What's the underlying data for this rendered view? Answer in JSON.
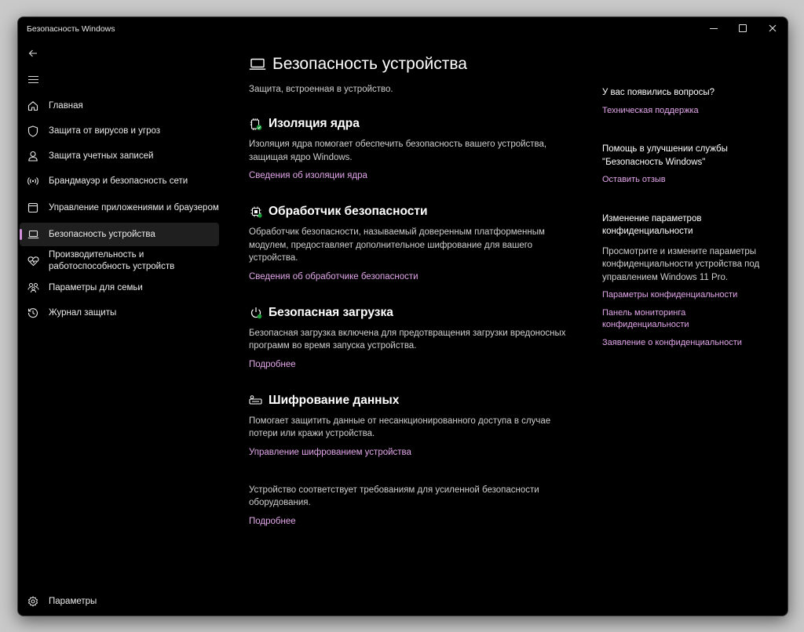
{
  "window": {
    "title": "Безопасность Windows",
    "accent": "#d38fdc",
    "link_color": "#e2a6ea"
  },
  "sidebar": {
    "items": [
      {
        "label": "Главная",
        "icon": "home-icon"
      },
      {
        "label": "Защита от вирусов и угроз",
        "icon": "shield-icon"
      },
      {
        "label": "Защита учетных записей",
        "icon": "person-icon"
      },
      {
        "label": "Брандмауэр и безопасность сети",
        "icon": "wifi-icon"
      },
      {
        "label": "Управление приложениями и браузером",
        "icon": "app-browser-icon"
      },
      {
        "label": "Безопасность устройства",
        "icon": "laptop-icon",
        "selected": true
      },
      {
        "label": "Производительность и работоспособность устройств",
        "icon": "heart-pulse-icon"
      },
      {
        "label": "Параметры для семьи",
        "icon": "family-icon"
      },
      {
        "label": "Журнал защиты",
        "icon": "history-icon"
      }
    ],
    "settings_label": "Параметры"
  },
  "main": {
    "title": "Безопасность устройства",
    "subtitle": "Защита, встроенная в устройство.",
    "sections": [
      {
        "title": "Изоляция ядра",
        "icon": "core-isolation-icon",
        "description": "Изоляция ядра помогает обеспечить безопасность вашего устройства, защищая ядро Windows.",
        "link": "Сведения об изоляции ядра"
      },
      {
        "title": "Обработчик безопасности",
        "icon": "chip-icon",
        "description": "Обработчик безопасности, называемый доверенным платформенным модулем, предоставляет дополнительное шифрование для вашего устройства.",
        "link": "Сведения об обработчике безопасности"
      },
      {
        "title": "Безопасная загрузка",
        "icon": "power-icon",
        "description": "Безопасная загрузка включена для предотвращения загрузки вредоносных программ во время запуска устройства.",
        "link": "Подробнее"
      },
      {
        "title": "Шифрование данных",
        "icon": "key-icon",
        "description": "Помогает защитить данные от несанкционированного доступа в случае потери или кражи устройства.",
        "link": "Управление шифрованием устройства"
      }
    ],
    "footer_note": "Устройство соответствует требованиям для усиленной безопасности оборудования.",
    "footer_link": "Подробнее"
  },
  "right": {
    "questions_heading": "У вас появились вопросы?",
    "support_link": "Техническая поддержка",
    "improve_heading": "Помощь в улучшении службы \"Безопасность Windows\"",
    "feedback_link": "Оставить отзыв",
    "privacy_heading": "Изменение параметров конфиденциальности",
    "privacy_text": "Просмотрите и измените параметры конфиденциальности устройства под управлением Windows 11 Pro.",
    "privacy_links": [
      "Параметры конфиденциальности",
      "Панель мониторинга конфиденциальности",
      "Заявление о конфиденциальности"
    ]
  }
}
